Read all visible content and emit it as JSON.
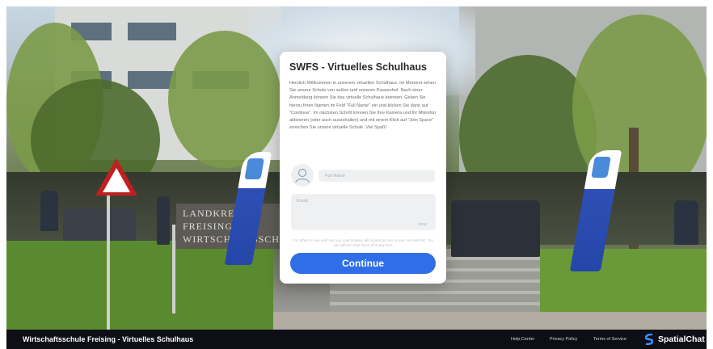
{
  "card": {
    "title": "SWFS - Virtuelles Schulhaus",
    "description": "Herzlich Willkommen in unserem virtuellen Schulhaus. Im Moment sehen Sie unsere Schule von außen und unseren Pausenhof. Nach einer Anmeldung können Sie das virtuelle Schulhaus betreten. Geben Sie hierzu Ihren Namen im Feld \"Full Name\" ein und klicken Sie dann auf \"Continue\". Im nächsten Schritt können Sie Ihre Kamera und Ihr Mikrofon aktivieren (oder auch ausschalten) und mit einem Klick auf \"Join Space\" erreichen Sie unsere virtuelle Schule. Viel Spaß!",
    "name_placeholder": "Full Name",
    "email_placeholder": "Email",
    "counter": "0/250",
    "privacy": "For others to see and hear you, your browser will request access to your cam and mic. You can still turn them back off at any time.",
    "continue_label": "Continue"
  },
  "background": {
    "stone_sign_text": "LANDKREIS FREISING WIRTSCHAFTSSCHULE"
  },
  "footer": {
    "title": "Wirtschaftsschule Freising - Virtuelles Schulhaus",
    "links": [
      "Help Center",
      "Privacy Policy",
      "Terms of Service"
    ],
    "brand": "SpatialChat"
  },
  "colors": {
    "accent": "#2f6ee6",
    "footer_bg": "#0d0e16"
  },
  "icons": {
    "avatar": "user-avatar-icon",
    "brand": "spatialchat-logo-icon"
  }
}
